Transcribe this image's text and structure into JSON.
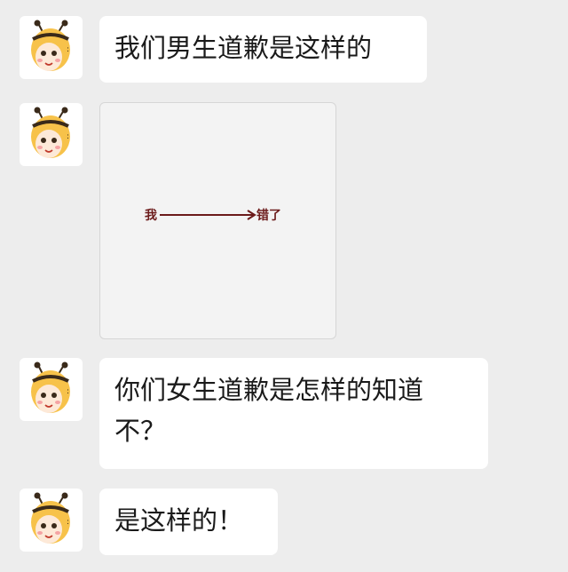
{
  "messages": [
    {
      "text": "我们男生道歉是这样的"
    },
    {
      "image": {
        "left_text": "我",
        "right_text": "错了",
        "arrow_color": "#6b1a1a"
      }
    },
    {
      "text_line1": "你们女生道歉是怎样的知道",
      "text_line2": "不？"
    },
    {
      "text": "是这样的！"
    }
  ],
  "avatar": {
    "icon": "bee-costume-cartoon-avatar"
  },
  "colors": {
    "background": "#ededed",
    "bubble": "#ffffff",
    "text": "#1a1a1a",
    "image_bg": "#f3f3f3",
    "arrow": "#6b1a1a"
  }
}
